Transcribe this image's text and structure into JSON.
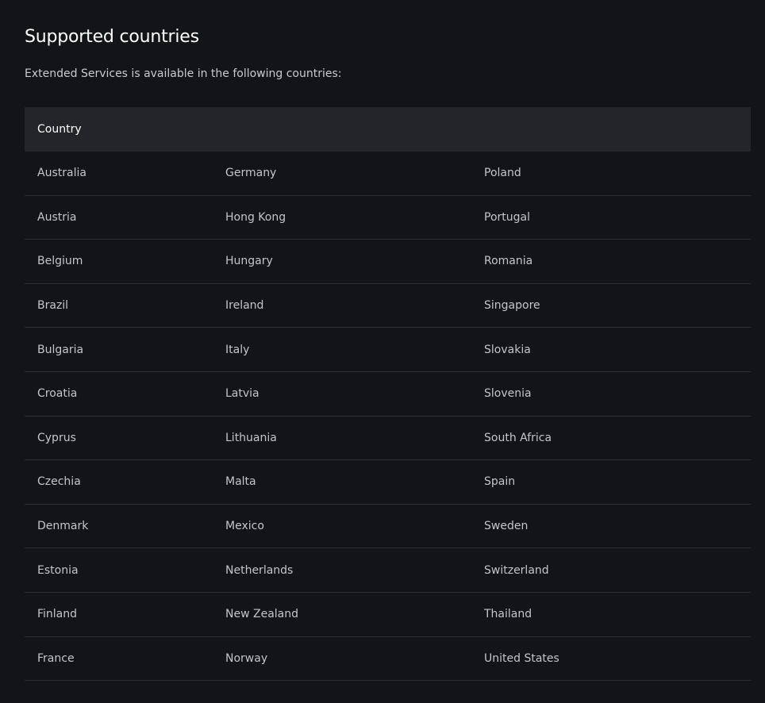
{
  "page": {
    "title": "Supported countries",
    "intro": "Extended Services is available in the following countries:"
  },
  "table": {
    "header": "Country",
    "rows": [
      [
        "Australia",
        "Germany",
        "Poland"
      ],
      [
        "Austria",
        "Hong Kong",
        "Portugal"
      ],
      [
        "Belgium",
        "Hungary",
        "Romania"
      ],
      [
        "Brazil",
        "Ireland",
        "Singapore"
      ],
      [
        "Bulgaria",
        "Italy",
        "Slovakia"
      ],
      [
        "Croatia",
        "Latvia",
        "Slovenia"
      ],
      [
        "Cyprus",
        "Lithuania",
        "South Africa"
      ],
      [
        "Czechia",
        "Malta",
        "Spain"
      ],
      [
        "Denmark",
        "Mexico",
        "Sweden"
      ],
      [
        "Estonia",
        "Netherlands",
        "Switzerland"
      ],
      [
        "Finland",
        "New Zealand",
        "Thailand"
      ],
      [
        "France",
        "Norway",
        "United States"
      ]
    ]
  },
  "colors": {
    "background": "#131418",
    "header_background": "#24252a",
    "row_divider": "#2d2e33",
    "title_text": "#ffffff",
    "body_text": "#c4c5cb"
  }
}
